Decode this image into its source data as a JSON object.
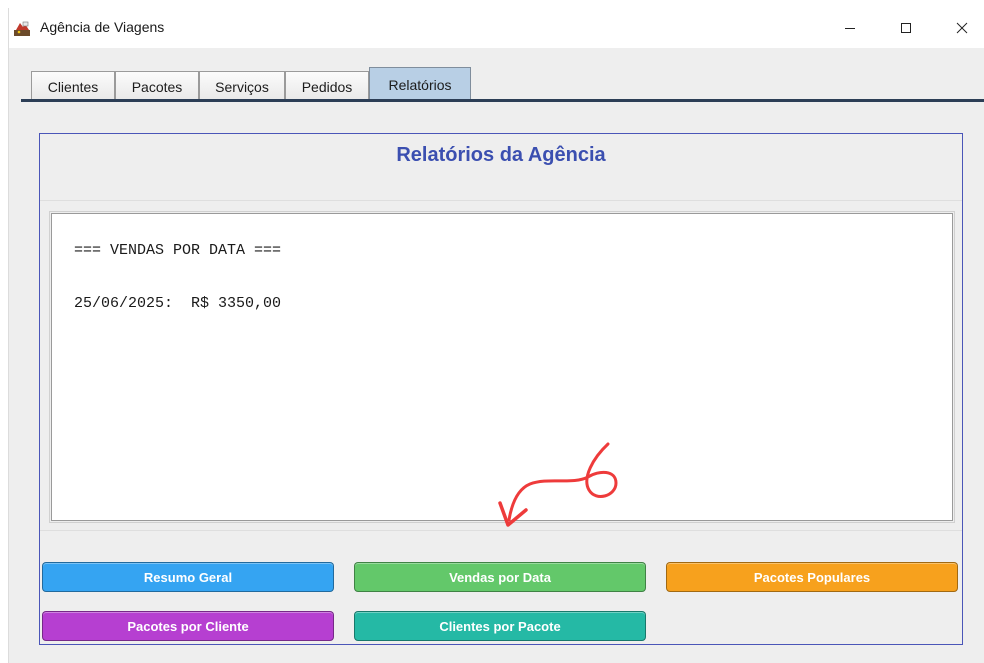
{
  "window": {
    "title": "Agência de Viagens"
  },
  "tabs": [
    {
      "label": "Clientes"
    },
    {
      "label": "Pacotes"
    },
    {
      "label": "Serviços"
    },
    {
      "label": "Pedidos"
    },
    {
      "label": "Relatórios"
    }
  ],
  "selected_tab": "Relatórios",
  "panel": {
    "title": "Relatórios da Agência",
    "report": {
      "heading": "=== VENDAS POR DATA ===",
      "lines": [
        {
          "text": "25/06/2025:  R$ 3350,00"
        }
      ]
    }
  },
  "buttons": [
    {
      "label": "Resumo Geral",
      "color": "#35a4f2"
    },
    {
      "label": "Vendas por Data",
      "color": "#63c86a"
    },
    {
      "label": "Pacotes Populares",
      "color": "#f7a11d"
    },
    {
      "label": "Pacotes por Cliente",
      "color": "#b63fd1"
    },
    {
      "label": "Clientes por Pacote",
      "color": "#25b9a5"
    }
  ],
  "annotation": {
    "label": "6",
    "color": "#ee3b3b"
  },
  "icons": {
    "app": "app-icon",
    "minimize": "minimize-icon",
    "maximize": "maximize-icon",
    "close": "close-icon"
  }
}
